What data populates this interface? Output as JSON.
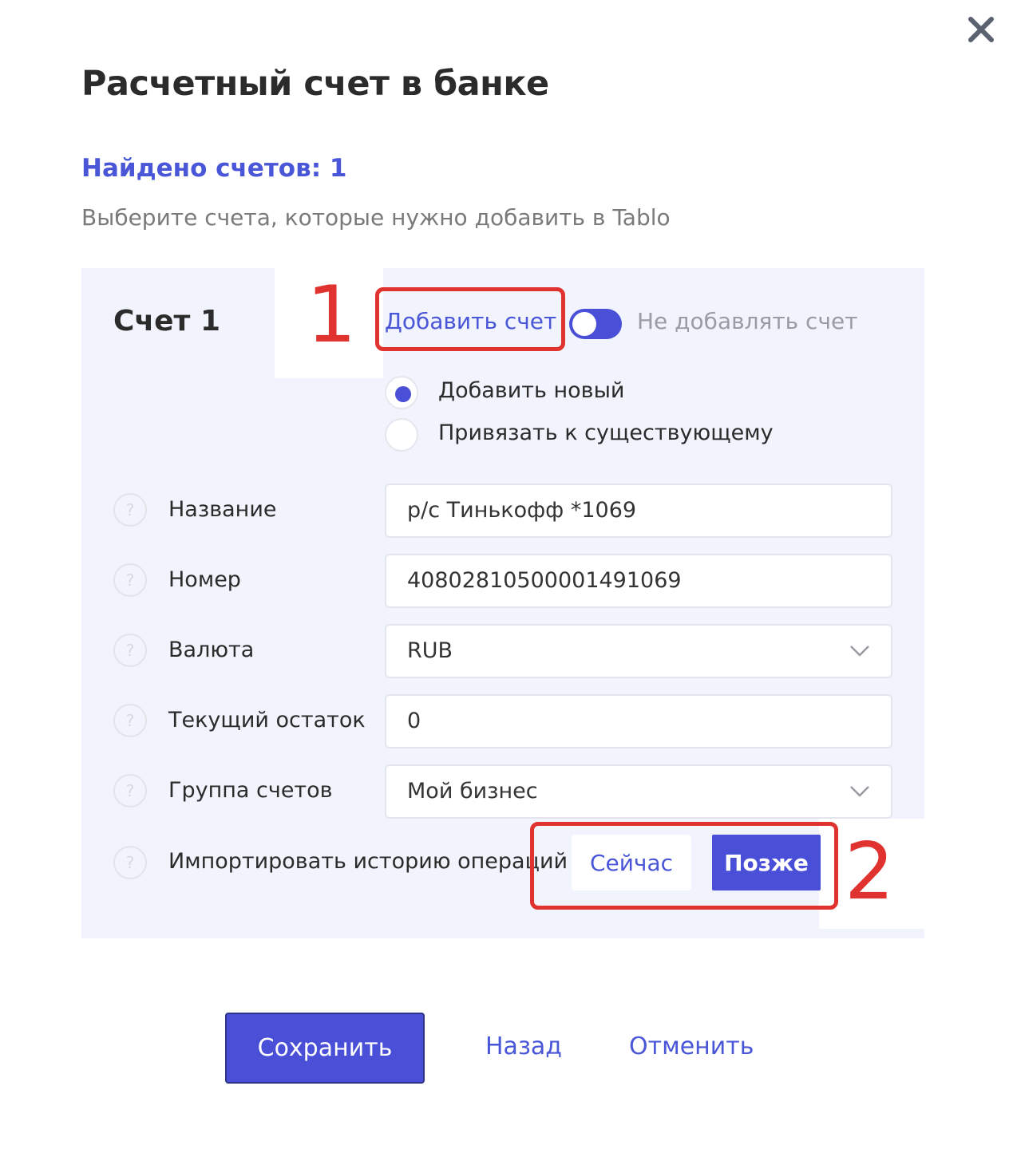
{
  "dialog": {
    "title": "Расчетный счет в банке",
    "found_text": "Найдено счетов: 1",
    "subtitle": "Выберите счета, которые нужно добавить в Tablo",
    "close_icon": "close-icon"
  },
  "account": {
    "title": "Счет 1",
    "add_link_label": "Добавить счет",
    "toggle_label": "Не добавлять счет",
    "toggle_on": true,
    "options": [
      {
        "label": "Добавить новый",
        "selected": true
      },
      {
        "label": "Привязать к существующему",
        "selected": false
      }
    ],
    "fields": [
      {
        "label": "Название",
        "value": "р/с Тинькофф *1069",
        "type": "text"
      },
      {
        "label": "Номер",
        "value": "40802810500001491069",
        "type": "text"
      },
      {
        "label": "Валюта",
        "value": "RUB",
        "type": "select"
      },
      {
        "label": "Текущий остаток",
        "value": "0",
        "type": "text"
      },
      {
        "label": "Группа счетов",
        "value": "Мой бизнес",
        "type": "select"
      }
    ],
    "import_history": {
      "label": "Импортировать историю операций",
      "now_label": "Сейчас",
      "later_label": "Позже",
      "selected": "Позже"
    },
    "help_glyph": "?"
  },
  "annotations": {
    "marker_1": "1",
    "marker_2": "2",
    "color": "#e0332f"
  },
  "footer": {
    "save_label": "Сохранить",
    "back_label": "Назад",
    "cancel_label": "Отменить"
  },
  "colors": {
    "accent": "#4a4fd8",
    "link": "#4a56d8",
    "panel_bg": "#f1f3fd"
  }
}
